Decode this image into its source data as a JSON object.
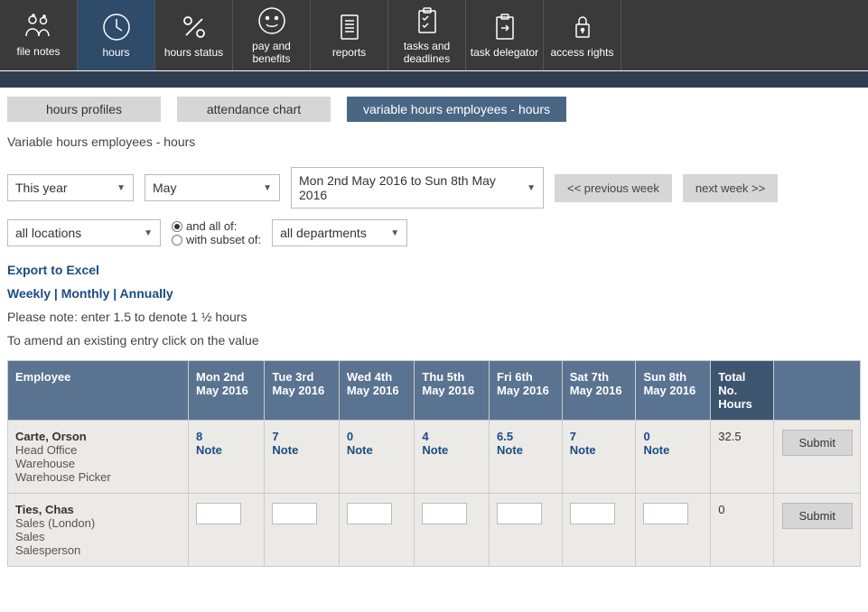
{
  "topnav": [
    {
      "label": "file notes"
    },
    {
      "label": "hours"
    },
    {
      "label": "hours status"
    },
    {
      "label": "pay and benefits"
    },
    {
      "label": "reports"
    },
    {
      "label": "tasks and deadlines"
    },
    {
      "label": "task delegator"
    },
    {
      "label": "access rights"
    }
  ],
  "subtabs": {
    "hours_profiles": "hours profiles",
    "attendance_chart": "attendance chart",
    "variable_hours": "variable hours employees - hours"
  },
  "heading": "Variable hours employees - hours",
  "filters": {
    "year": "This year",
    "month": "May",
    "week_range": "Mon 2nd May 2016 to Sun 8th May 2016",
    "prev_week": "<< previous week",
    "next_week": "next week >>",
    "location": "all locations",
    "radio_all": "and all of:",
    "radio_subset": "with subset of:",
    "department": "all departments"
  },
  "links": {
    "export": "Export to Excel",
    "weekly": "Weekly",
    "monthly": "Monthly",
    "annually": "Annually"
  },
  "notes": {
    "line1": "Please note: enter 1.5 to denote 1 ½ hours",
    "line2": "To amend an existing entry click on the value"
  },
  "table": {
    "headers": {
      "employee": "Employee",
      "days": [
        "Mon 2nd May 2016",
        "Tue 3rd May 2016",
        "Wed 4th May 2016",
        "Thu 5th May 2016",
        "Fri 6th May 2016",
        "Sat 7th May 2016",
        "Sun 8th May 2016"
      ],
      "total": "Total No. Hours"
    },
    "note_label": "Note",
    "submit_label": "Submit",
    "rows": [
      {
        "name": "Carte, Orson",
        "lines": [
          "Head Office",
          "Warehouse",
          "Warehouse Picker"
        ],
        "values": [
          "8",
          "7",
          "0",
          "4",
          "6.5",
          "7",
          "0"
        ],
        "total": "32.5",
        "editable": false
      },
      {
        "name": "Ties, Chas",
        "lines": [
          "Sales (London)",
          "Sales",
          "Salesperson"
        ],
        "values": [
          "",
          "",
          "",
          "",
          "",
          "",
          ""
        ],
        "total": "0",
        "editable": true
      }
    ]
  }
}
